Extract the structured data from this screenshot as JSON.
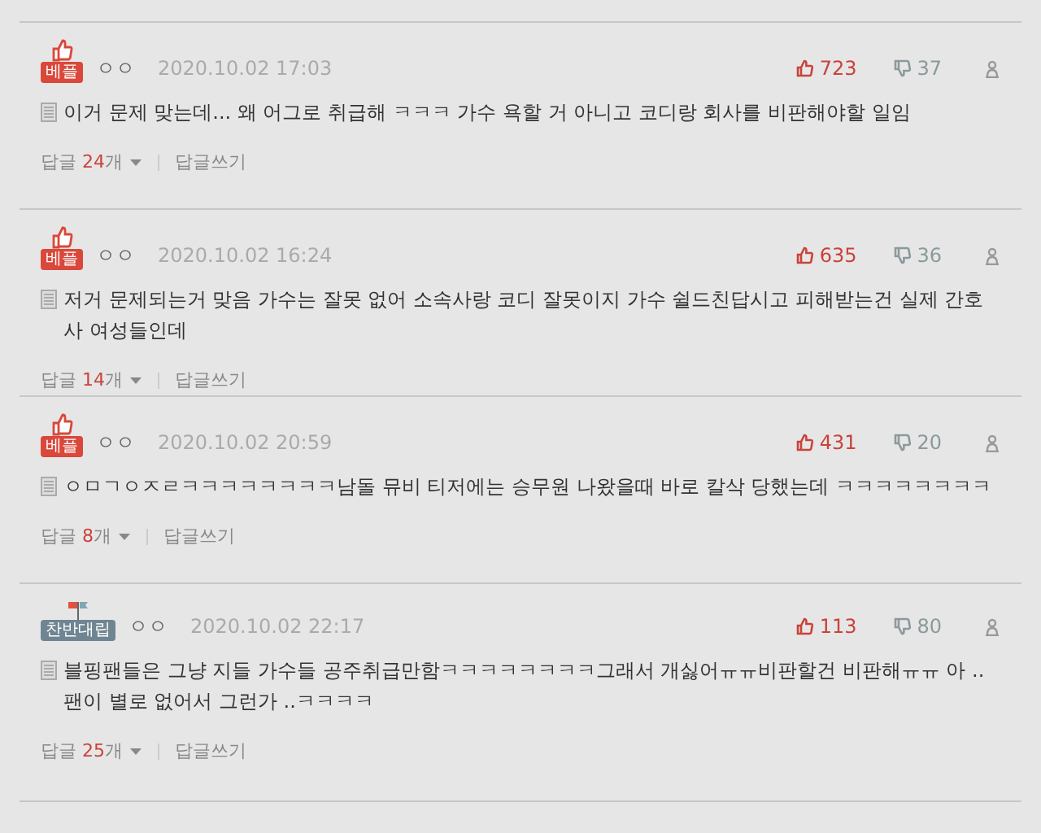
{
  "comments": [
    {
      "badge": {
        "kind": "best",
        "label": "베플"
      },
      "author": "ㅇㅇ",
      "date": "2020.10.02 17:03",
      "likes": "723",
      "dislikes": "37",
      "text": "이거 문제 맞는데... 왜 어그로 취급해 ㅋㅋㅋ 가수 욕할 거 아니고 코디랑 회사를 비판해야할 일임",
      "reply_label": "답글",
      "reply_count": "24",
      "reply_unit": "개",
      "write_reply": "답글쓰기"
    },
    {
      "badge": {
        "kind": "best",
        "label": "베플"
      },
      "author": "ㅇㅇ",
      "date": "2020.10.02 16:24",
      "likes": "635",
      "dislikes": "36",
      "text": "저거 문제되는거 맞음 가수는 잘못 없어 소속사랑 코디 잘못이지 가수 쉴드친답시고 피해받는건 실제 간호사 여성들인데",
      "reply_label": "답글",
      "reply_count": "14",
      "reply_unit": "개",
      "write_reply": "답글쓰기"
    },
    {
      "badge": {
        "kind": "best",
        "label": "베플"
      },
      "author": "ㅇㅇ",
      "date": "2020.10.02 20:59",
      "likes": "431",
      "dislikes": "20",
      "text": "ㅇㅁㄱㅇㅈㄹㅋㅋㅋㅋㅋㅋㅋㅋ남돌 뮤비 티저에는 승무원 나왔을때 바로 칼삭 당했는데 ㅋㅋㅋㅋㅋㅋㅋㅋ",
      "reply_label": "답글",
      "reply_count": "8",
      "reply_unit": "개",
      "write_reply": "답글쓰기"
    },
    {
      "badge": {
        "kind": "debate",
        "label": "찬반대립"
      },
      "author": "ㅇㅇ",
      "date": "2020.10.02 22:17",
      "likes": "113",
      "dislikes": "80",
      "text": "블핑팬들은 그냥 지들 가수들 공주취급만함ㅋㅋㅋㅋㅋㅋㅋㅋ그래서 개싫어ㅠㅠ비판할건 비판해ㅠㅠ 아 ..팬이 별로 없어서 그런가 ..ㅋㅋㅋㅋ",
      "reply_label": "답글",
      "reply_count": "25",
      "reply_unit": "개",
      "write_reply": "답글쓰기"
    }
  ]
}
